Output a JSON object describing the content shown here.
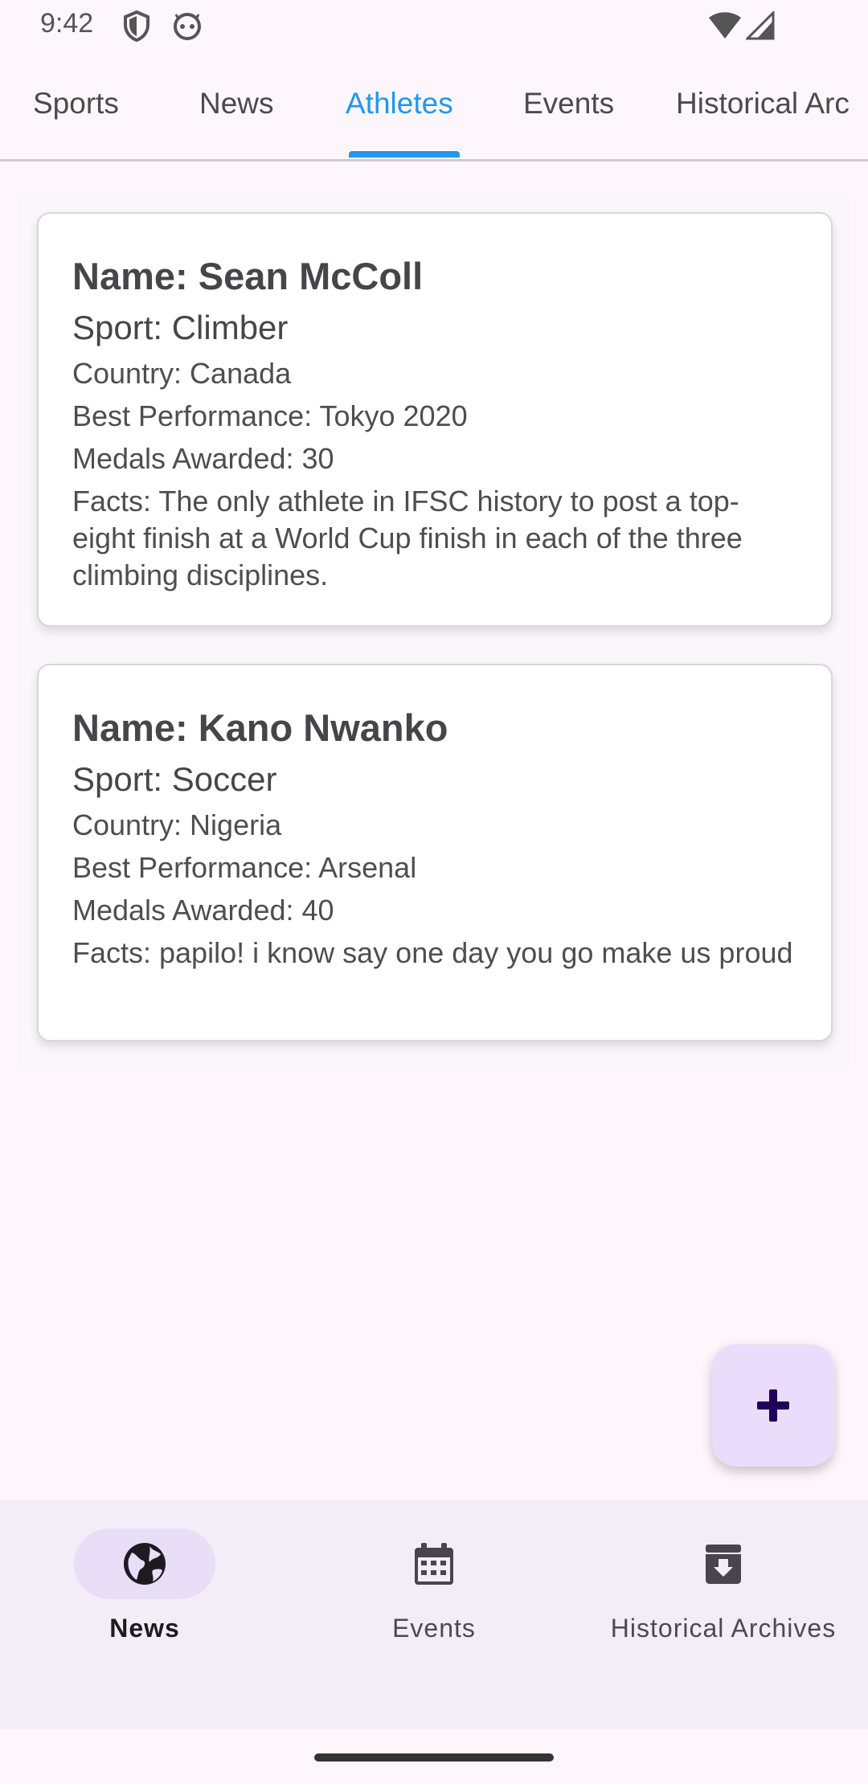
{
  "status_bar": {
    "time": "9:42",
    "icons": [
      "shield-icon",
      "android-face-icon",
      "wifi-icon",
      "signal-icon"
    ]
  },
  "tabs": [
    {
      "label": "Sports",
      "active": false
    },
    {
      "label": "News",
      "active": false
    },
    {
      "label": "Athletes",
      "active": true
    },
    {
      "label": "Events",
      "active": false
    },
    {
      "label": "Historical Arc",
      "active": false
    }
  ],
  "athletes": [
    {
      "name": "Name: Sean McColl",
      "sport": "Sport: Climber",
      "country": "Country: Canada",
      "best_performance": "Best Performance: Tokyo 2020",
      "medals": "Medals Awarded: 30",
      "facts": "Facts: The only athlete in IFSC history to post a top-eight finish at a World Cup finish in each of the three climbing disciplines."
    },
    {
      "name": "Name: Kano Nwanko",
      "sport": "Sport: Soccer",
      "country": "Country: Nigeria",
      "best_performance": "Best Performance: Arsenal",
      "medals": "Medals Awarded: 40",
      "facts": "Facts: papilo! i know say one day you go make us proud"
    }
  ],
  "fab": {
    "icon": "plus-icon"
  },
  "bottom_nav": [
    {
      "label": "News",
      "icon": "globe-icon",
      "active": true
    },
    {
      "label": "Events",
      "icon": "calendar-icon",
      "active": false
    },
    {
      "label": "Historical Archives",
      "icon": "archive-icon",
      "active": false
    }
  ],
  "colors": {
    "accent": "#2196f3",
    "background": "#fdf7fd",
    "nav_background": "#f3edf7",
    "nav_active_pill": "#e8def8",
    "fab_background": "#e9ddfb"
  }
}
